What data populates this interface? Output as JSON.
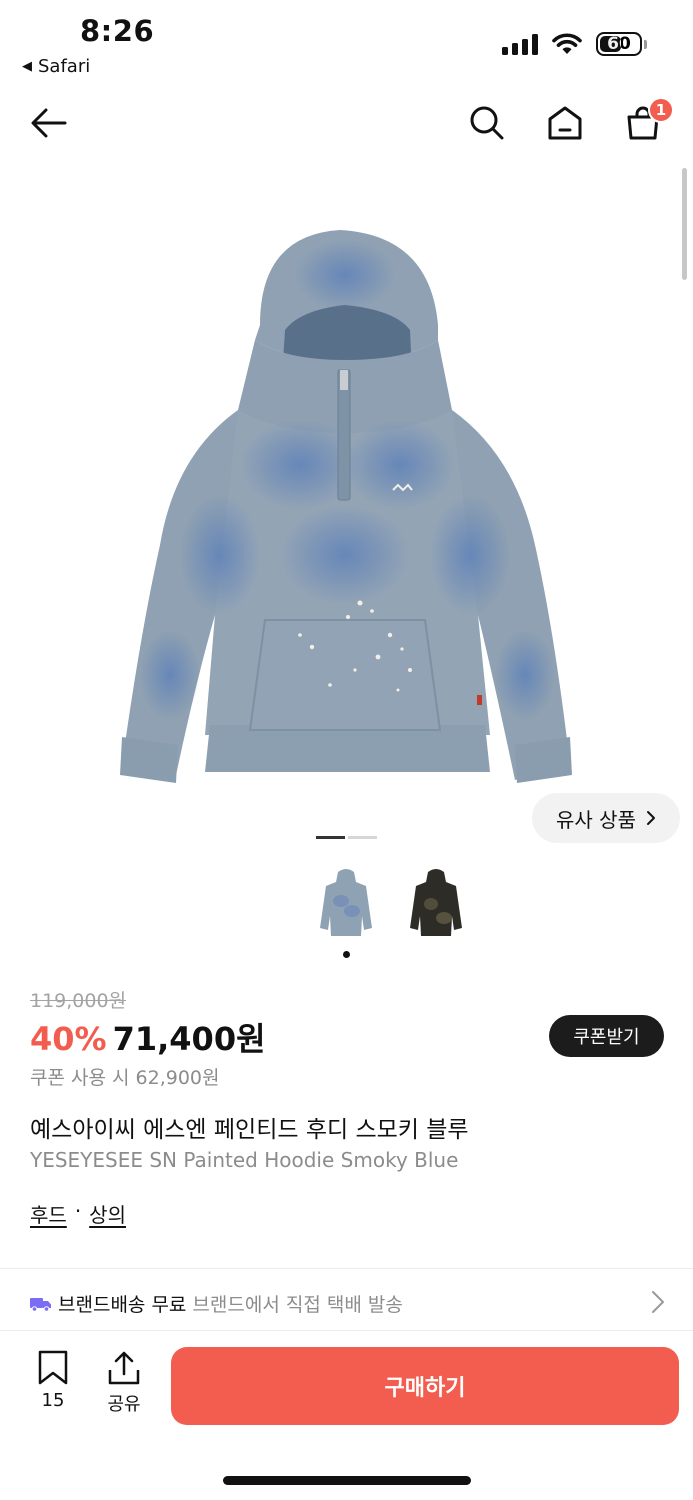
{
  "status_bar": {
    "time": "8:26",
    "back_app": "Safari",
    "battery": "60",
    "battery_level": 0.6
  },
  "nav": {
    "back_icon": "arrow-left-icon",
    "search_icon": "search-icon",
    "home_icon": "home-icon",
    "cart_icon": "shopping-bag-icon",
    "cart_count": "1"
  },
  "gallery": {
    "similar_label": "유사 상품",
    "similar_icon": "chevron-right-icon",
    "thumbnails": [
      "smoky-blue-hoodie",
      "black-hoodie"
    ]
  },
  "product": {
    "original_price": "119,000원",
    "discount": "40%",
    "sale_price": "71,400원",
    "coupon_button": "쿠폰받기",
    "coupon_price": "쿠폰 사용 시 62,900원",
    "name_ko": "예스아이씨 에스엔 페인티드 후디 스모키 블루",
    "name_en": "YESEYESEE SN Painted Hoodie Smoky Blue",
    "category_1": "후드",
    "category_separator": "·",
    "category_2": "상의"
  },
  "shipping": {
    "icon": "truck-icon",
    "highlight": "브랜드배송 무료",
    "detail": "브랜드에서 직접 택배 발송"
  },
  "bottom_bar": {
    "like_count": "15",
    "share_label": "공유",
    "buy_label": "구매하기"
  },
  "colors": {
    "accent": "#f25d4f",
    "text": "#111111",
    "muted": "#8c8c8c",
    "hoodie_blue": "#8fa2b4",
    "hoodie_dark": "#2d2c27"
  }
}
